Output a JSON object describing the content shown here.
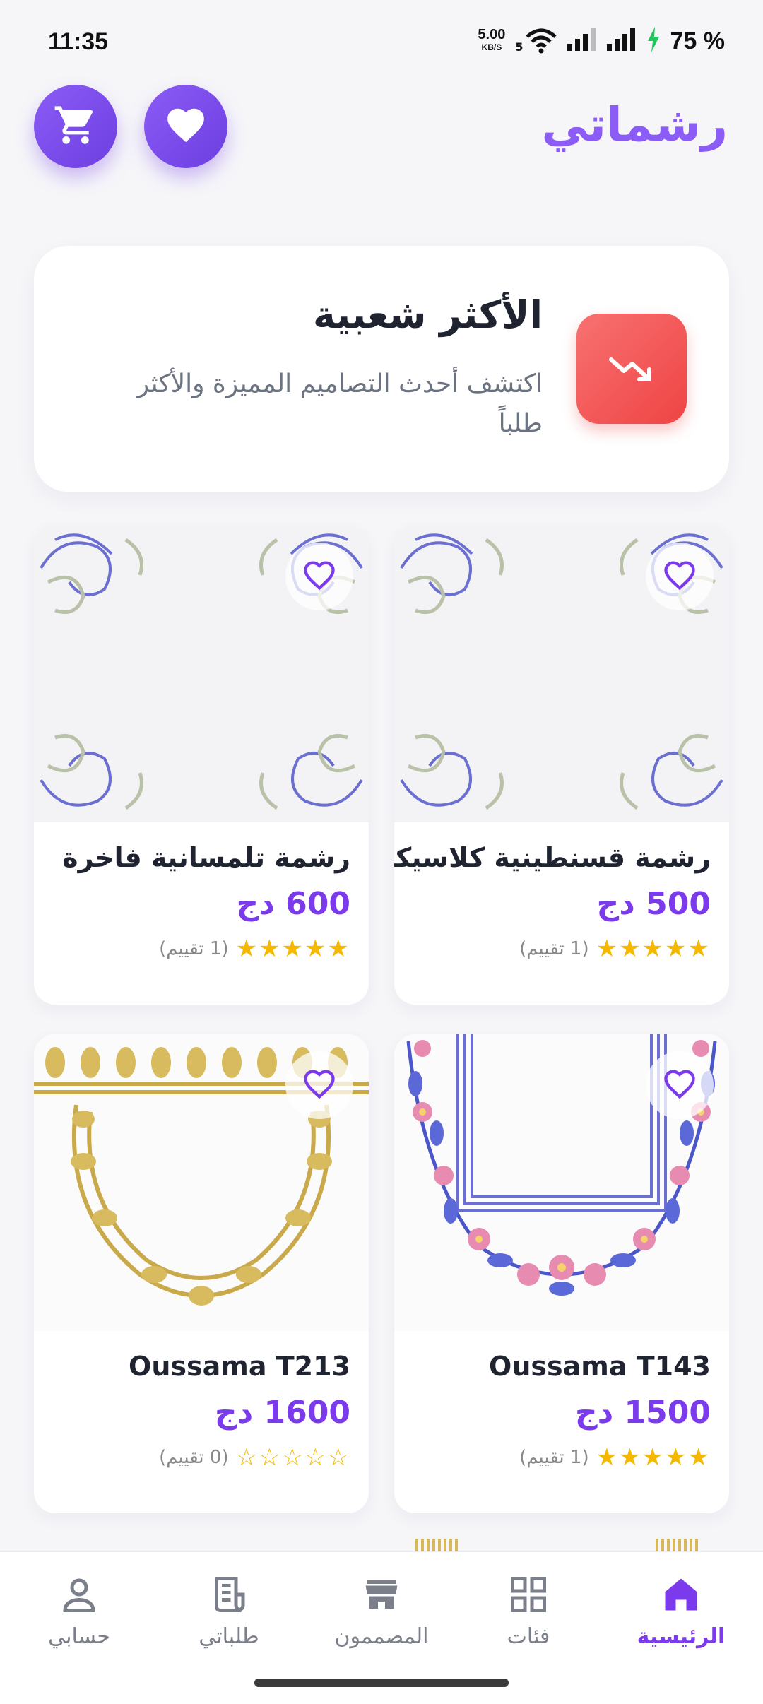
{
  "status_bar": {
    "time": "11:35",
    "net_speed": "5.00",
    "net_unit": "KB/S",
    "network_gen": "5",
    "battery": "75 %"
  },
  "header": {
    "app_name": "رشماتي",
    "cart_icon": "cart-icon",
    "favorites_icon": "heart-icon"
  },
  "hero": {
    "title": "الأكثر شعبية",
    "subtitle": "اكتشف أحدث التصاميم المميزة والأكثر طلباً",
    "icon": "trending-down-icon",
    "accent": "#ef4444"
  },
  "products": [
    {
      "title": "رشمة قسنطينية كلاسيكية",
      "price": "500 دج",
      "rating": 5,
      "count": "(1 تقييم)"
    },
    {
      "title": "رشمة تلمسانية فاخرة",
      "price": "600 دج",
      "rating": 5,
      "count": "(1 تقييم)"
    },
    {
      "title": "Oussama T143",
      "price": "1500 دج",
      "rating": 5,
      "count": "(1 تقييم)"
    },
    {
      "title": "Oussama T213",
      "price": "1600 دج",
      "rating": 0,
      "count": "(0 تقييم)"
    }
  ],
  "bottom_nav": {
    "items": [
      {
        "label": "الرئيسية",
        "icon": "home-icon",
        "active": true
      },
      {
        "label": "فئات",
        "icon": "grid-icon",
        "active": false
      },
      {
        "label": "المصممون",
        "icon": "store-icon",
        "active": false
      },
      {
        "label": "طلباتي",
        "icon": "receipt-icon",
        "active": false
      },
      {
        "label": "حسابي",
        "icon": "person-icon",
        "active": false
      }
    ]
  },
  "colors": {
    "primary": "#7c3aed",
    "star": "#f5b800",
    "background": "#f6f6f9"
  }
}
